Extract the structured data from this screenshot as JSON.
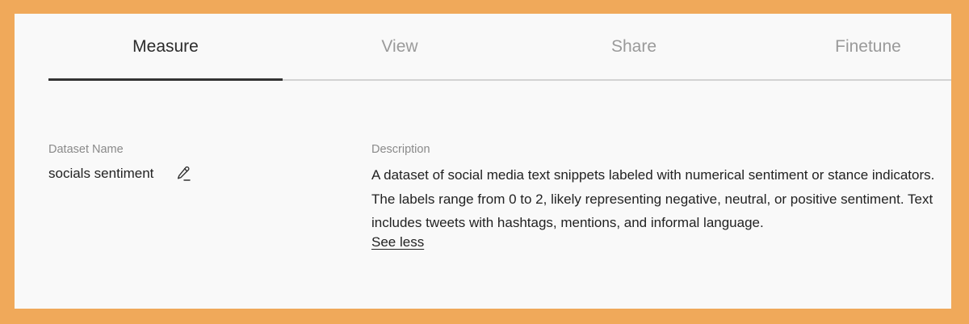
{
  "tabs": [
    {
      "label": "Measure",
      "active": true
    },
    {
      "label": "View",
      "active": false
    },
    {
      "label": "Share",
      "active": false
    },
    {
      "label": "Finetune",
      "active": false
    }
  ],
  "dataset": {
    "name_label": "Dataset Name",
    "name_value": "socials sentiment",
    "edit_icon": "pencil-icon"
  },
  "description": {
    "label": "Description",
    "text": "A dataset of social media text snippets labeled with numerical sentiment or stance indicators. The labels range from 0 to 2, likely representing negative, neutral, or positive sentiment. Text includes tweets with hashtags, mentions, and informal language.",
    "toggle_label": "See less"
  },
  "colors": {
    "page_background": "#F0A95A",
    "panel_background": "#F9F9F9",
    "active_tab_indicator": "#333333"
  }
}
